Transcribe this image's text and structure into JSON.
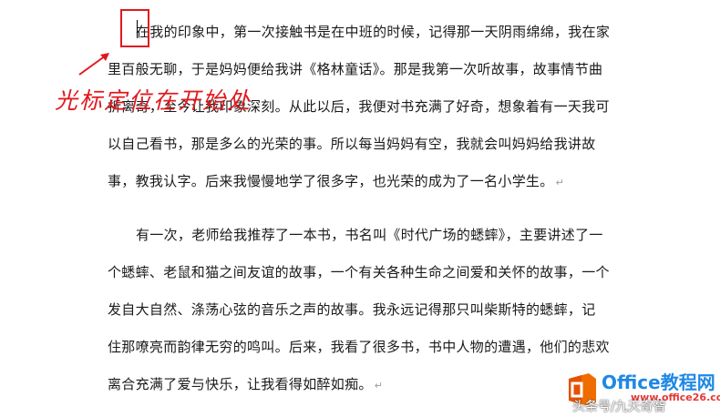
{
  "document": {
    "paragraphs": [
      {
        "lines": [
          "在我的印象中，第一次接触书是在中班的时候，记得那一天阴雨绵绵，我在家",
          "里百般无聊，于是妈妈便给我讲《格林童话》。那是我第一次听故事，故事情节曲",
          "折离奇，至今让我印象深刻。从此以后，我便对书充满了好奇，想象着有一天我可",
          "以自己看书，那是多么的光荣的事。所以每当妈妈有空，我就会叫妈妈给我讲故",
          "事，教我认字。后来我慢慢地学了很多字，也光荣的成为了一名小学生。"
        ],
        "end_mark": "↵"
      },
      {
        "lines": [
          "有一次，老师给我推荐了一本书，书名叫《时代广场的蟋蟀》，主要讲述了一",
          "个蟋蟀、老鼠和猫之间友谊的故事，一个有关各种生命之间爱和关怀的故事，一个",
          "发自大自然、涤荡心弦的音乐之声的故事。我永远记得那只叫柴斯特的蟋蟀，记",
          "住那嘹亮而韵律无穷的鸣叫。后来，我看了很多书，书中人物的遭遇，他们的悲欢",
          "离合充满了爱与快乐，让我看得如醉如痴。"
        ],
        "end_mark": "↵"
      }
    ]
  },
  "annotation": {
    "text": "光标定位在开始处",
    "color": "#e0191f"
  },
  "watermark": {
    "title": "Office教程网",
    "url": "www.office26.com",
    "subtitle": "头条号/九天奇智"
  },
  "icons": {
    "arrow": "arrow-up-right-icon",
    "logo": "office-logo-icon"
  }
}
